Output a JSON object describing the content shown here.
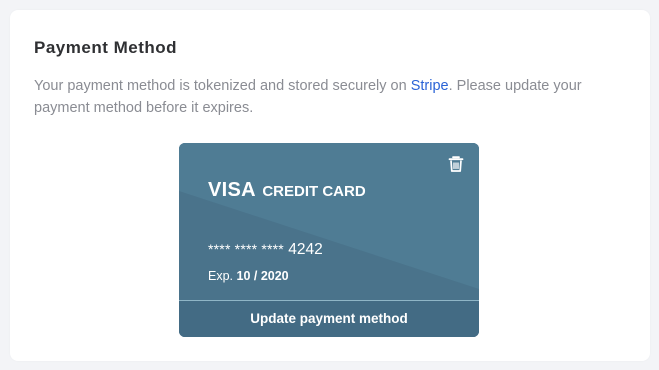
{
  "section": {
    "title": "Payment Method",
    "description_before": "Your payment method is tokenized and stored securely on ",
    "provider_link": "Stripe",
    "description_after": ". Please update your payment method before it expires."
  },
  "card": {
    "brand": "VISA",
    "type_label": "CREDIT CARD",
    "masked": "**** **** ****",
    "last4": "4242",
    "exp_label": "Exp.",
    "exp_date": "10 / 2020",
    "delete_icon": "trash-icon",
    "update_label": "Update payment method"
  },
  "colors": {
    "card_bg": "#4b758d",
    "card_light": "#4f7b93",
    "card_footer": "#436b84",
    "link": "#2a63d6"
  }
}
